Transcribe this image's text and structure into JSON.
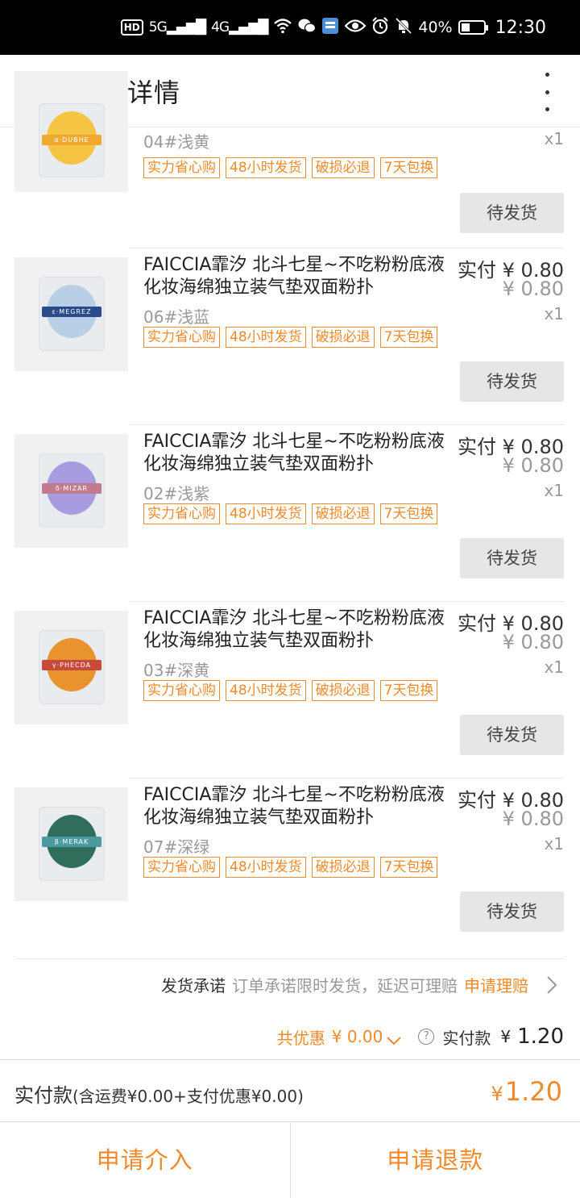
{
  "status_bar": {
    "hd": "HD",
    "sig1": "5G",
    "sig2": "4G",
    "battery": "40%",
    "battery_level": 0.4,
    "time": "12:30"
  },
  "header": {
    "title": "订单详情"
  },
  "tags": [
    "实力省心购",
    "48小时发货",
    "破损必退",
    "7天包换"
  ],
  "items": [
    {
      "sku": "04#浅黄",
      "qty": "x1",
      "status": "待发货",
      "color": "#f6c443",
      "band_color": "#f0a930",
      "band_text": "α·DUBHE"
    },
    {
      "title": "FAICCIA霏汐 北斗七星~不吃粉粉底液化妆海绵独立装气垫双面粉扑",
      "paid": "实付 ¥ 0.80",
      "orig": "¥ 0.80",
      "sku": "06#浅蓝",
      "qty": "x1",
      "status": "待发货",
      "color": "#b8cfe6",
      "band_color": "#2a4a8a",
      "band_text": "ε·MEGREZ"
    },
    {
      "title": "FAICCIA霏汐 北斗七星~不吃粉粉底液化妆海绵独立装气垫双面粉扑",
      "paid": "实付 ¥ 0.80",
      "orig": "¥ 0.80",
      "sku": "02#浅紫",
      "qty": "x1",
      "status": "待发货",
      "color": "#a99be0",
      "band_color": "#c27a8e",
      "band_text": "δ·MIZAR"
    },
    {
      "title": "FAICCIA霏汐 北斗七星~不吃粉粉底液化妆海绵独立装气垫双面粉扑",
      "paid": "实付 ¥ 0.80",
      "orig": "¥ 0.80",
      "sku": "03#深黄",
      "qty": "x1",
      "status": "待发货",
      "color": "#e8932e",
      "band_color": "#c84a3a",
      "band_text": "γ·PHECDA"
    },
    {
      "title": "FAICCIA霏汐 北斗七星~不吃粉粉底液化妆海绵独立装气垫双面粉扑",
      "paid": "实付 ¥ 0.80",
      "orig": "¥ 0.80",
      "sku": "07#深绿",
      "qty": "x1",
      "status": "待发货",
      "color": "#2f6e5a",
      "band_color": "#4a9aa0",
      "band_text": "β·MERAK"
    }
  ],
  "promise": {
    "label": "发货承诺",
    "text": "订单承诺限时发货，延迟可理赔",
    "claim": "申请理赔"
  },
  "summary": {
    "discount_label": "共优惠",
    "discount_value": "¥ 0.00",
    "help": "?",
    "paid_label": "实付款",
    "yen": "¥",
    "total": "1.20"
  },
  "payline": {
    "label": "实付款",
    "detail": "(含运费¥0.00+支付优惠¥0.00)",
    "yen": "¥",
    "total": "1.20"
  },
  "actions": {
    "intervene": "申请介入",
    "refund": "申请退款"
  },
  "colors": {
    "accent": "#f08a2a"
  }
}
